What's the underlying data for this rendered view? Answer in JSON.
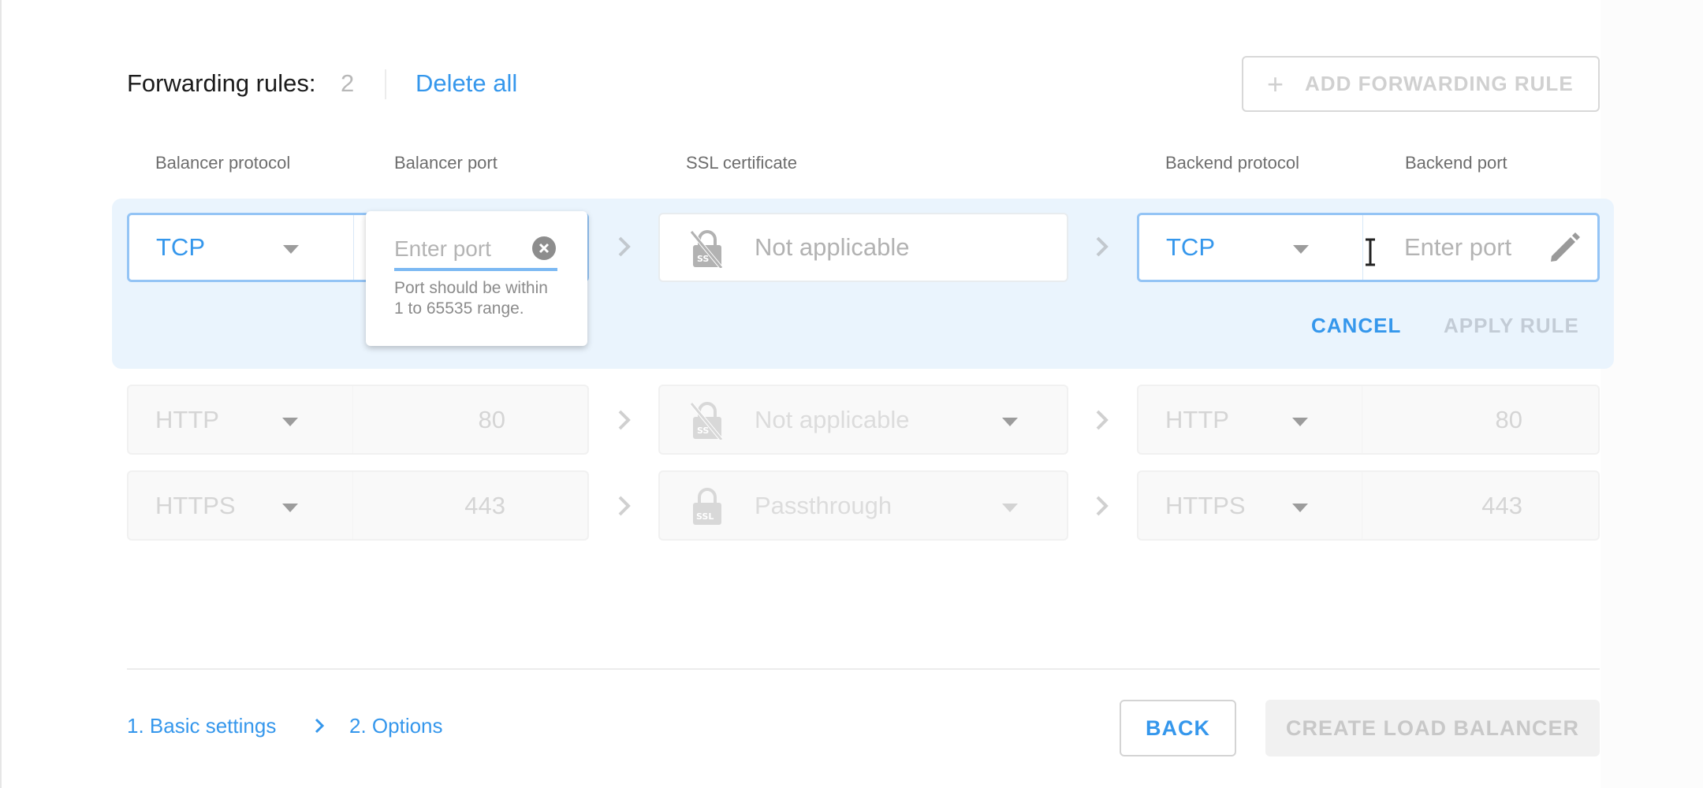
{
  "header": {
    "title": "Forwarding rules:",
    "count": "2",
    "delete_all": "Delete all",
    "add_rule_button": "ADD FORWARDING RULE",
    "add_rule_icon": "plus-icon"
  },
  "columns": {
    "balancer_protocol": "Balancer protocol",
    "balancer_port": "Balancer port",
    "ssl_certificate": "SSL certificate",
    "backend_protocol": "Backend protocol",
    "backend_port": "Backend port"
  },
  "edit_rule": {
    "balancer_protocol": "TCP",
    "balancer_port_placeholder": "Enter port",
    "balancer_port_help": "Port should be within 1 to 65535 range.",
    "ssl_certificate": "Not applicable",
    "ssl_icon": "ssl-lock-off-icon",
    "backend_protocol": "TCP",
    "backend_port_placeholder": "Enter port",
    "cancel_label": "CANCEL",
    "apply_label": "APPLY RULE"
  },
  "rules": [
    {
      "balancer_protocol": "HTTP",
      "balancer_port": "80",
      "ssl_certificate": "Not applicable",
      "ssl_icon": "ssl-lock-off-icon",
      "backend_protocol": "HTTP",
      "backend_port": "80"
    },
    {
      "balancer_protocol": "HTTPS",
      "balancer_port": "443",
      "ssl_certificate": "Passthrough",
      "ssl_icon": "ssl-lock-icon",
      "backend_protocol": "HTTPS",
      "backend_port": "443"
    }
  ],
  "footer": {
    "steps": [
      "1. Basic settings",
      "2. Options"
    ],
    "back_label": "BACK",
    "create_label": "CREATE LOAD BALANCER"
  },
  "colors": {
    "accent": "#3597ec",
    "edit_panel_bg": "#eaf4fd",
    "active_border": "#94c4f5",
    "disabled_text": "#d5d5d5"
  }
}
